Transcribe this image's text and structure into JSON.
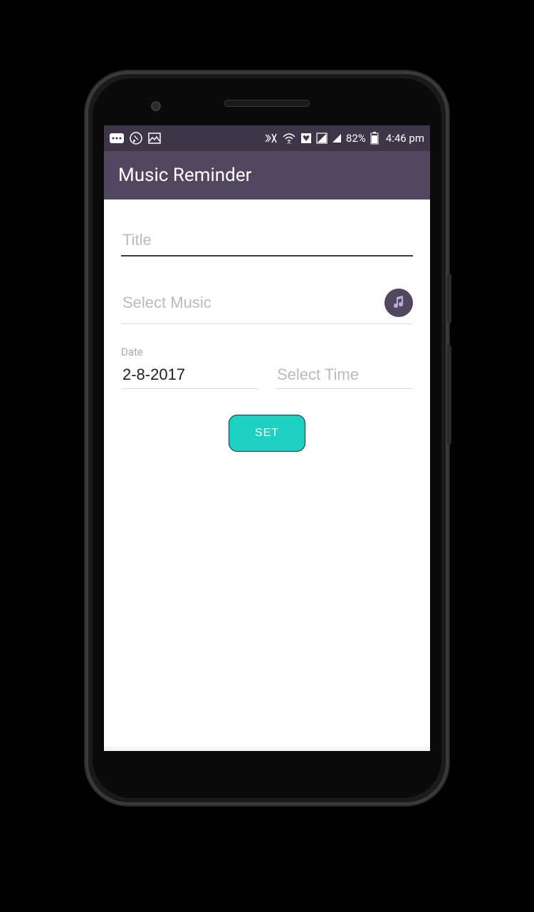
{
  "status": {
    "battery_percent": "82%",
    "time": "4:46 pm"
  },
  "app_bar": {
    "title": "Music Reminder"
  },
  "form": {
    "title_placeholder": "Title",
    "title_value": "",
    "music_placeholder": "Select Music",
    "music_value": "",
    "date_label": "Date",
    "date_value": "2-8-2017",
    "time_placeholder": "Select Time",
    "time_value": "",
    "set_label": "SET"
  },
  "colors": {
    "primary": "#51475e",
    "primary_dark": "#3d3548",
    "accent": "#1dd1c1"
  }
}
